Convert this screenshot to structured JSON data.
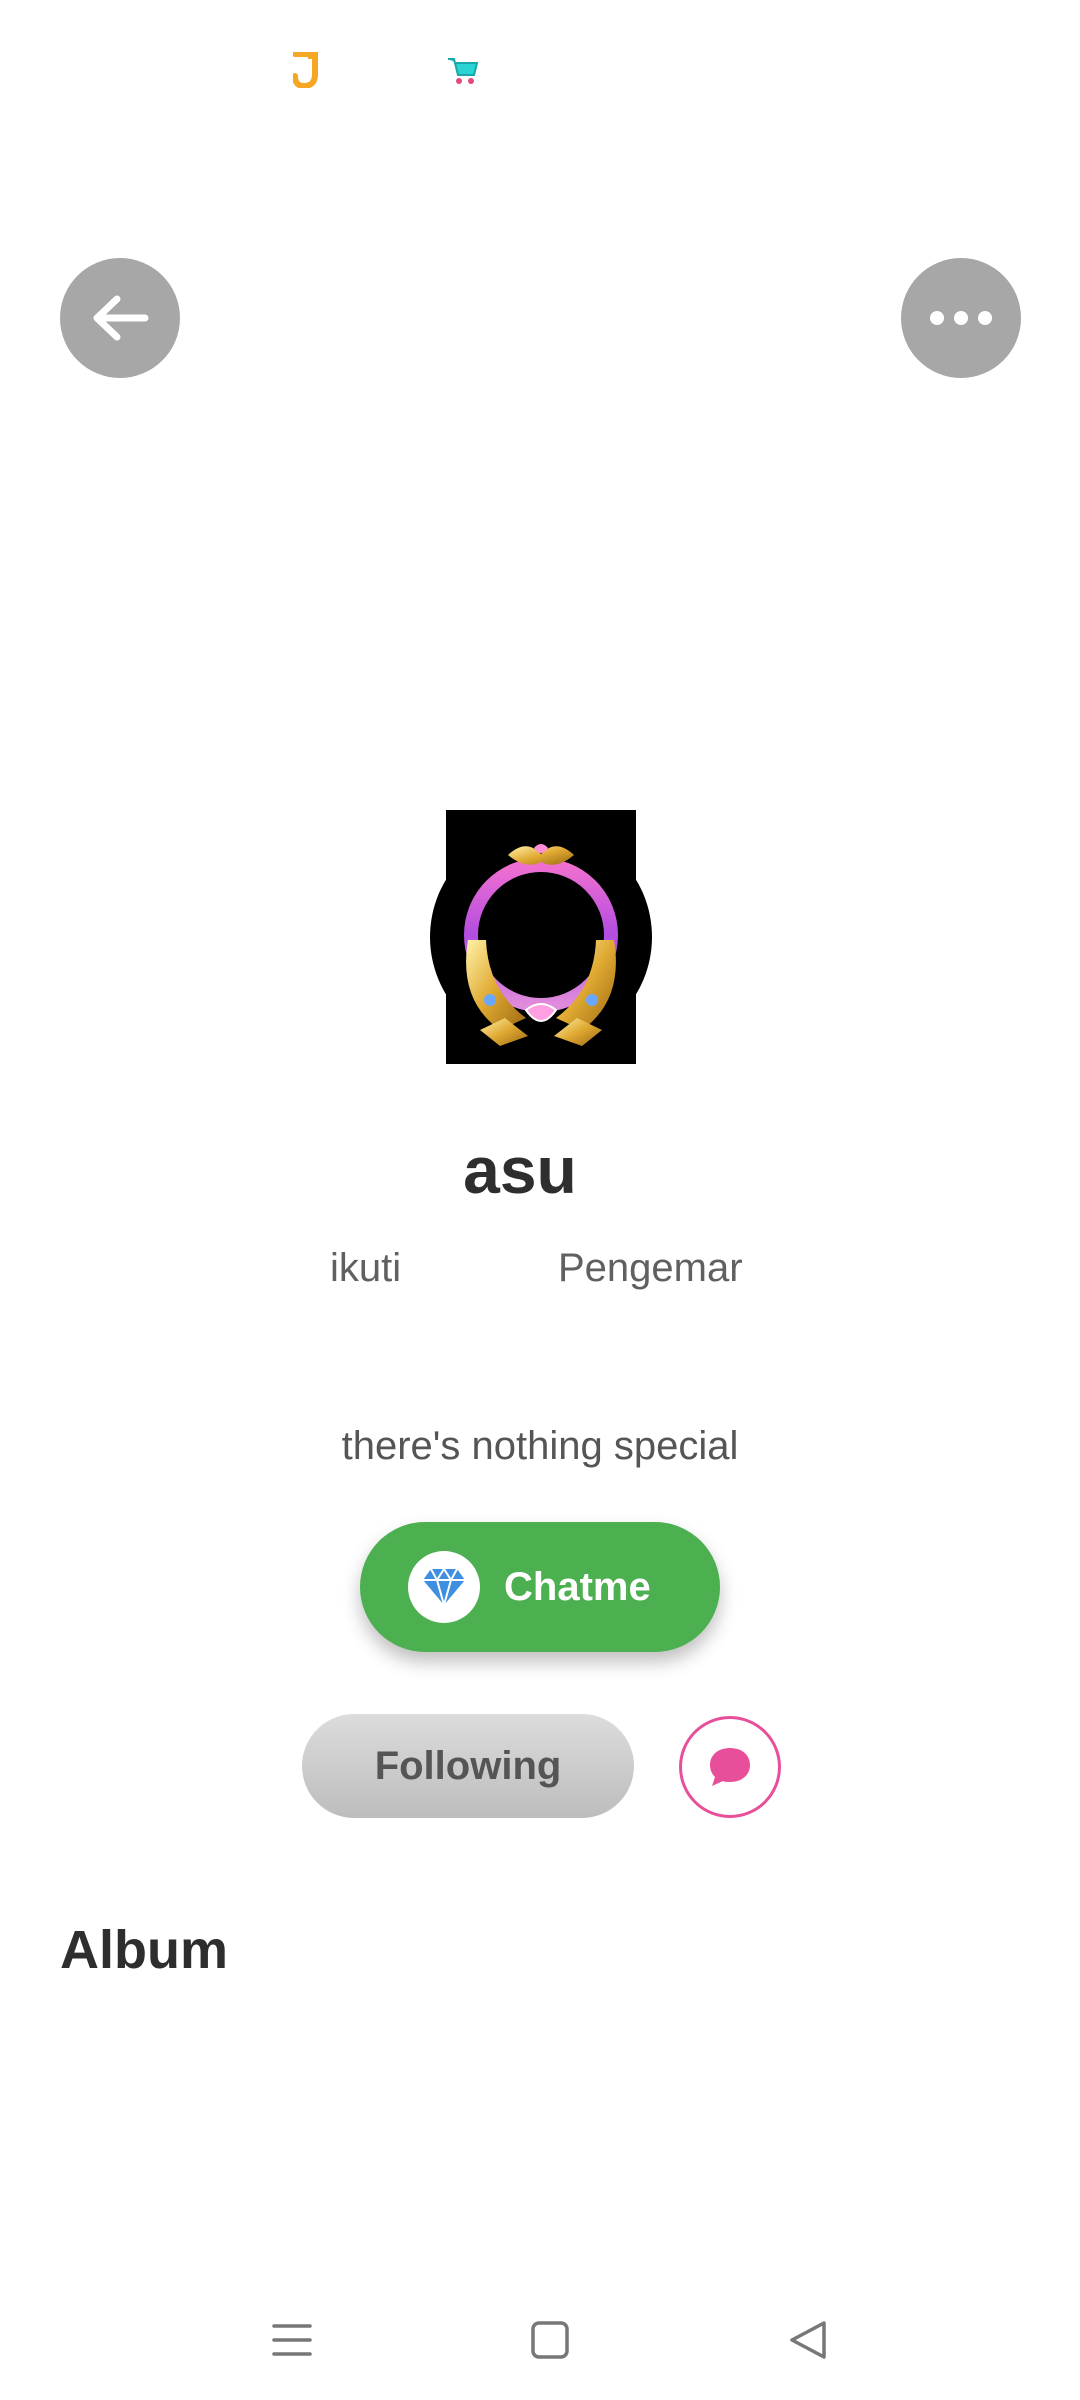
{
  "status_bar": {
    "left_icon": "j-app-icon",
    "right_icon": "shopping-cart-icon"
  },
  "header": {
    "back_icon": "arrow-left-icon",
    "more_icon": "more-horizontal-icon"
  },
  "profile": {
    "avatar": "avatar-frame-image",
    "username": "asu",
    "following_label": "ikuti",
    "fans_label": "Pengemar",
    "bio": "there's nothing special"
  },
  "actions": {
    "chatme_label": "Chatme",
    "chatme_icon": "diamond-icon",
    "following_label": "Following",
    "message_icon": "chat-bubble-icon"
  },
  "sections": {
    "album_title": "Album"
  },
  "navigation": {
    "items": [
      "menu-icon",
      "home-square-icon",
      "back-triangle-icon"
    ]
  },
  "colors": {
    "chatme_green": "#4caf50",
    "message_pink": "#e84f9a",
    "button_gray": "#a7a7a7"
  }
}
